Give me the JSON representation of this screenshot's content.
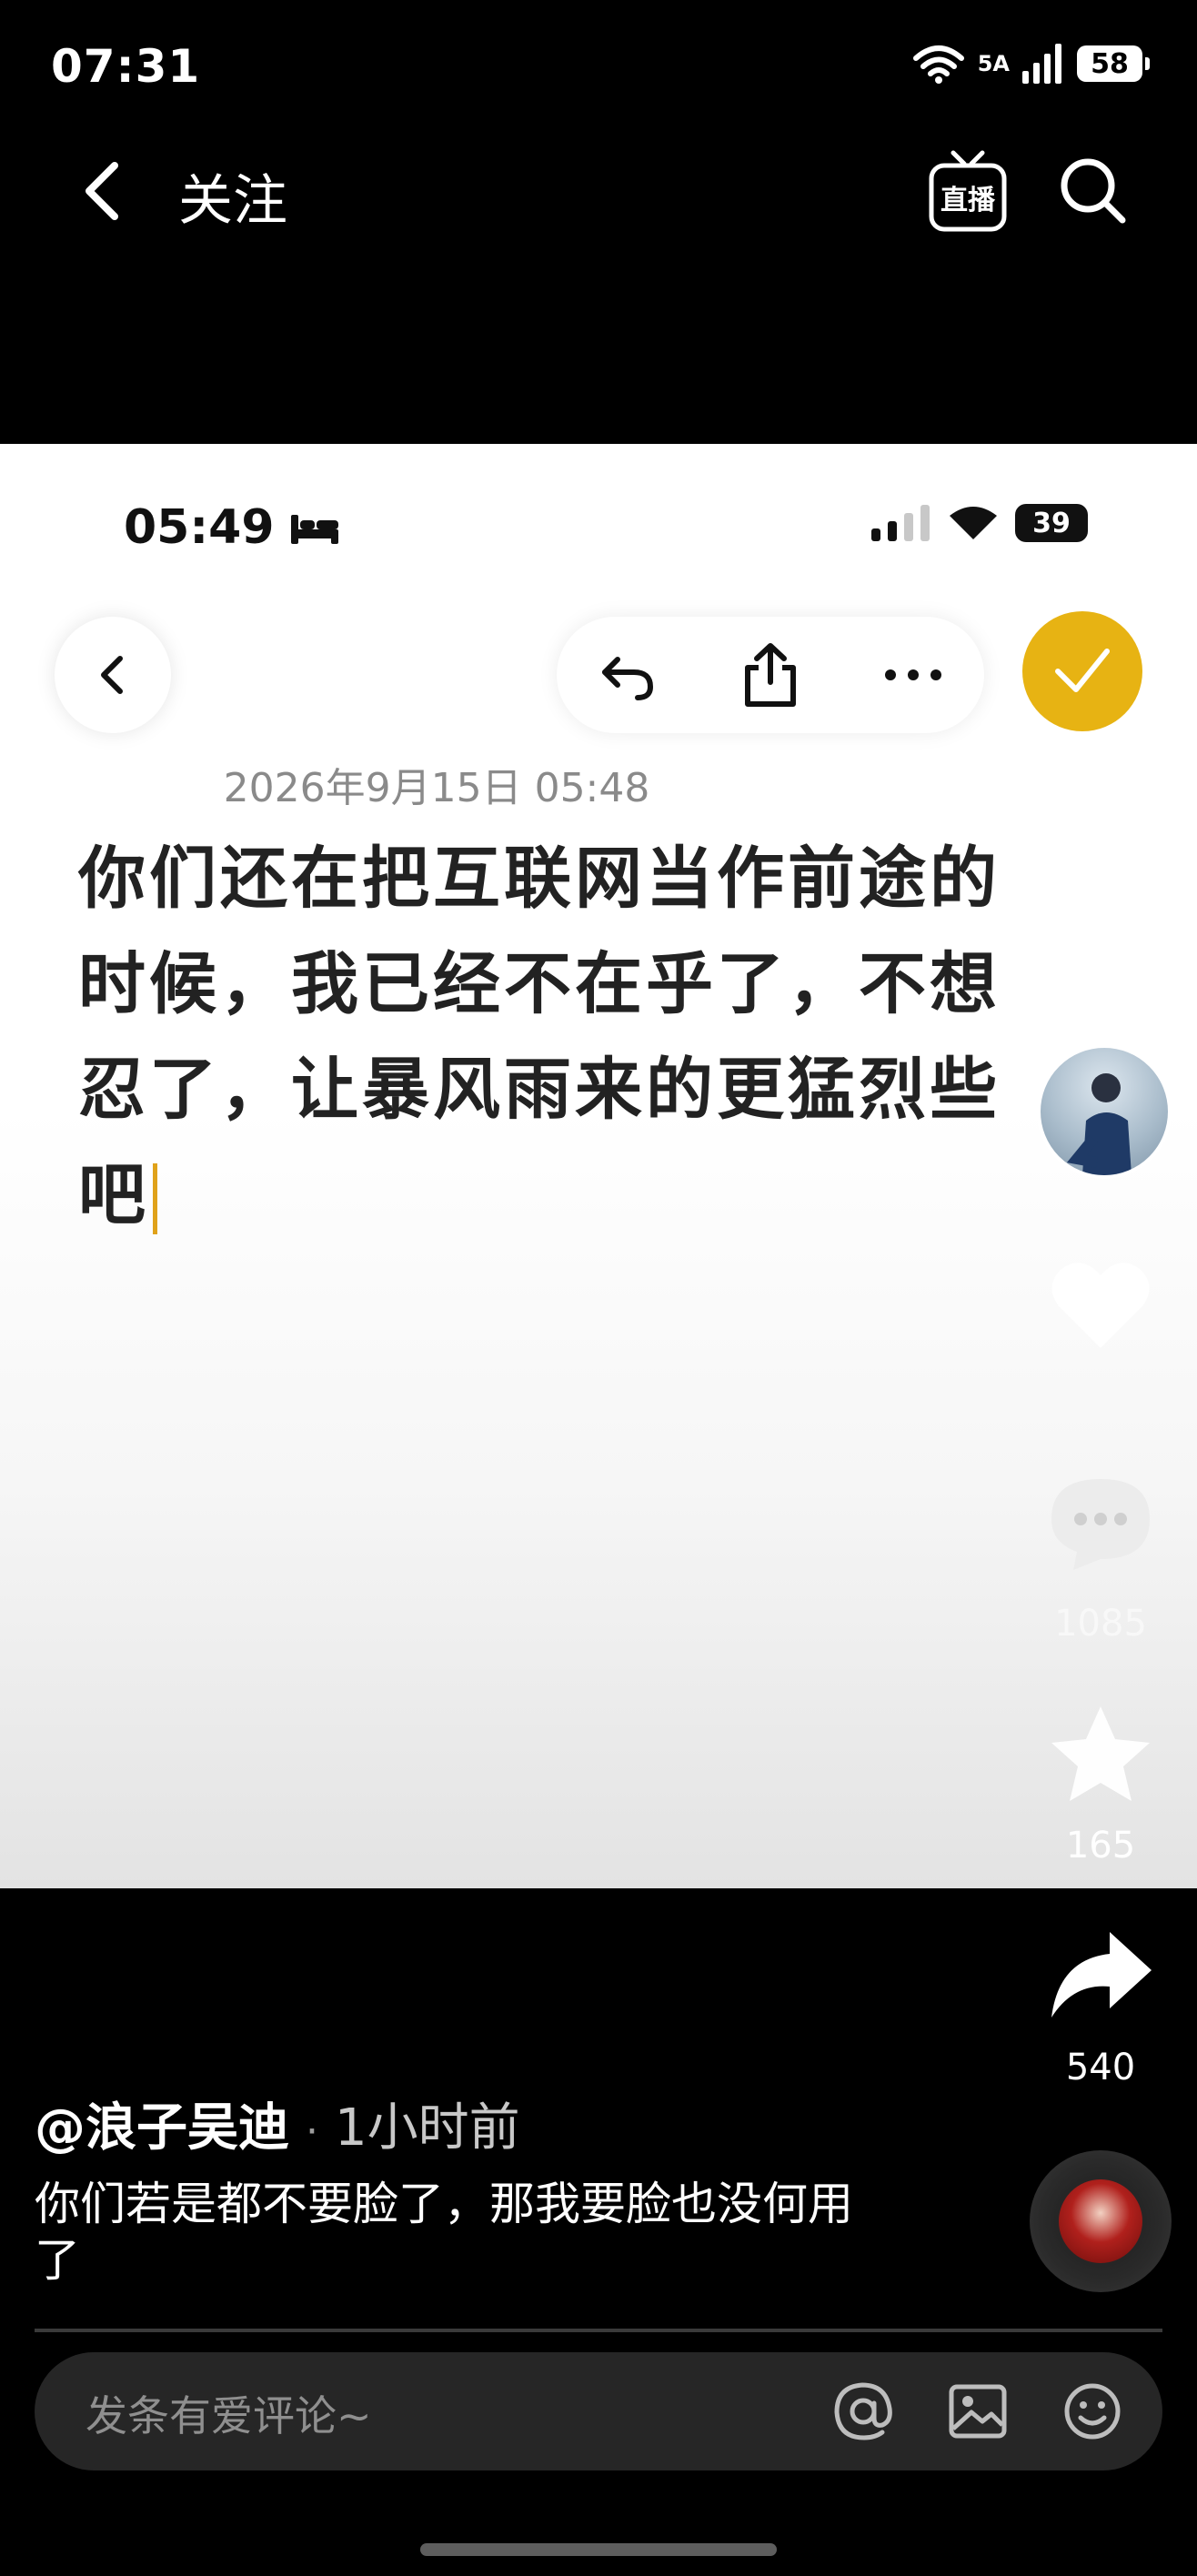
{
  "status_bar": {
    "time": "07:31",
    "network_label": "5A",
    "battery": "58"
  },
  "nav": {
    "title": "关注",
    "back_icon": "chevron-left-icon",
    "live_icon": "live-tv-icon",
    "live_label": "直播",
    "search_icon": "search-icon"
  },
  "post_image": {
    "inner_status": {
      "time": "05:49",
      "battery": "39"
    },
    "date": "2026年9月15日 05:48",
    "text": "你们还在把互联网当作前途的时候，我已经不在乎了，不想忍了，让暴风雨来的更猛烈些吧",
    "accent_color": "#e7b313"
  },
  "actions": {
    "comment_count": "1085",
    "favorite_count": "165",
    "share_count": "540"
  },
  "caption": {
    "author": "@浪子吴迪",
    "separator": "·",
    "time_ago": "1小时前",
    "text": "你们若是都不要脸了，那我要脸也没何用了"
  },
  "comment_bar": {
    "placeholder": "发条有爱评论~"
  }
}
